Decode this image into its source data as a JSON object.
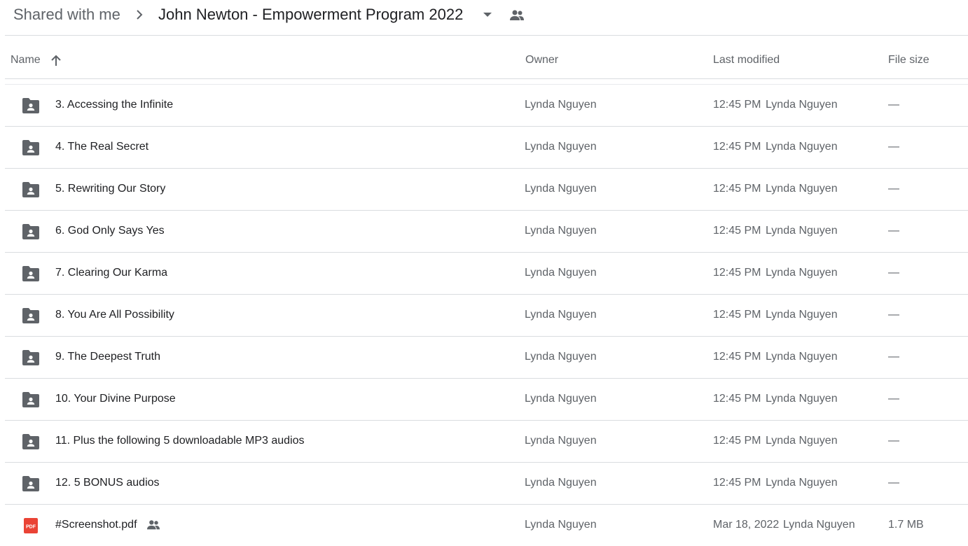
{
  "breadcrumb": {
    "root": "Shared with me",
    "separator_icon": "chevron-right-icon",
    "current": "John Newton - Empowerment Program 2022",
    "dropdown_icon": "caret-down-icon",
    "shared_icon": "people-icon"
  },
  "columns": {
    "name": "Name",
    "sort_icon": "arrow-up-icon",
    "owner": "Owner",
    "last_modified": "Last modified",
    "file_size": "File size"
  },
  "colors": {
    "folder_icon": "#5f6368",
    "pdf_icon": "#ea4335",
    "divider": "#dadce0",
    "text_primary": "#202124",
    "text_secondary": "#5f6368"
  },
  "rows": [
    {
      "icon": "shared-folder-icon",
      "name": "3. Accessing the Infinite",
      "owner": "Lynda Nguyen",
      "modified_date": "12:45 PM",
      "modified_by": "Lynda Nguyen",
      "size": "—"
    },
    {
      "icon": "shared-folder-icon",
      "name": "4. The Real Secret",
      "owner": "Lynda Nguyen",
      "modified_date": "12:45 PM",
      "modified_by": "Lynda Nguyen",
      "size": "—"
    },
    {
      "icon": "shared-folder-icon",
      "name": "5. Rewriting Our Story",
      "owner": "Lynda Nguyen",
      "modified_date": "12:45 PM",
      "modified_by": "Lynda Nguyen",
      "size": "—"
    },
    {
      "icon": "shared-folder-icon",
      "name": "6. God Only Says Yes",
      "owner": "Lynda Nguyen",
      "modified_date": "12:45 PM",
      "modified_by": "Lynda Nguyen",
      "size": "—"
    },
    {
      "icon": "shared-folder-icon",
      "name": "7. Clearing Our Karma",
      "owner": "Lynda Nguyen",
      "modified_date": "12:45 PM",
      "modified_by": "Lynda Nguyen",
      "size": "—"
    },
    {
      "icon": "shared-folder-icon",
      "name": "8. You Are All Possibility",
      "owner": "Lynda Nguyen",
      "modified_date": "12:45 PM",
      "modified_by": "Lynda Nguyen",
      "size": "—"
    },
    {
      "icon": "shared-folder-icon",
      "name": "9. The Deepest Truth",
      "owner": "Lynda Nguyen",
      "modified_date": "12:45 PM",
      "modified_by": "Lynda Nguyen",
      "size": "—"
    },
    {
      "icon": "shared-folder-icon",
      "name": "10. Your Divine Purpose",
      "owner": "Lynda Nguyen",
      "modified_date": "12:45 PM",
      "modified_by": "Lynda Nguyen",
      "size": "—"
    },
    {
      "icon": "shared-folder-icon",
      "name": "11. Plus the following 5 downloadable MP3 audios",
      "owner": "Lynda Nguyen",
      "modified_date": "12:45 PM",
      "modified_by": "Lynda Nguyen",
      "size": "—"
    },
    {
      "icon": "shared-folder-icon",
      "name": "12. 5 BONUS audios",
      "owner": "Lynda Nguyen",
      "modified_date": "12:45 PM",
      "modified_by": "Lynda Nguyen",
      "size": "—"
    },
    {
      "icon": "pdf-icon",
      "icon_label": "PDF",
      "name": "#Screenshot.pdf",
      "shared_icon": "people-icon",
      "owner": "Lynda Nguyen",
      "modified_date": "Mar 18, 2022",
      "modified_by": "Lynda Nguyen",
      "size": "1.7 MB"
    }
  ]
}
